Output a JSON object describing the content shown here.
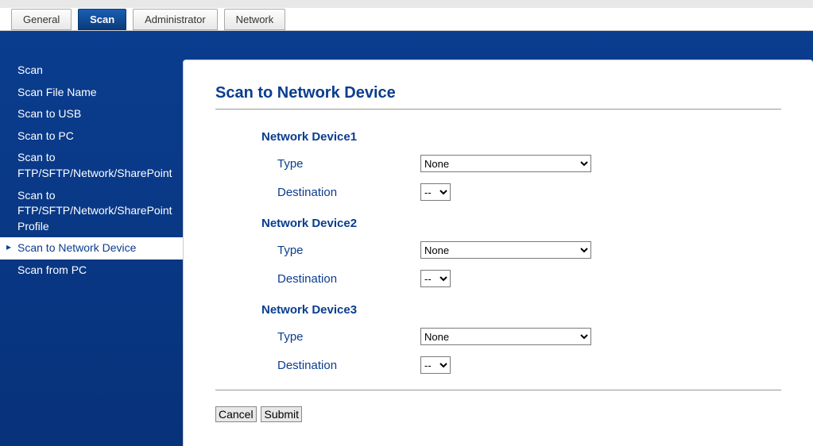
{
  "tabs": [
    {
      "label": "General",
      "active": false
    },
    {
      "label": "Scan",
      "active": true
    },
    {
      "label": "Administrator",
      "active": false
    },
    {
      "label": "Network",
      "active": false
    }
  ],
  "sidebar": {
    "items": [
      {
        "label": "Scan",
        "active": false
      },
      {
        "label": "Scan File Name",
        "active": false
      },
      {
        "label": "Scan to USB",
        "active": false
      },
      {
        "label": "Scan to PC",
        "active": false
      },
      {
        "label": "Scan to FTP/SFTP/Network/SharePoint",
        "active": false
      },
      {
        "label": "Scan to FTP/SFTP/Network/SharePoint Profile",
        "active": false
      },
      {
        "label": "Scan to Network Device",
        "active": true
      },
      {
        "label": "Scan from PC",
        "active": false
      }
    ]
  },
  "page": {
    "title": "Scan to Network Device",
    "devices": [
      {
        "heading": "Network Device1",
        "type_label": "Type",
        "type_value": "None",
        "destination_label": "Destination",
        "destination_value": "--"
      },
      {
        "heading": "Network Device2",
        "type_label": "Type",
        "type_value": "None",
        "destination_label": "Destination",
        "destination_value": "--"
      },
      {
        "heading": "Network Device3",
        "type_label": "Type",
        "type_value": "None",
        "destination_label": "Destination",
        "destination_value": "--"
      }
    ],
    "actions": {
      "cancel": "Cancel",
      "submit": "Submit"
    }
  }
}
